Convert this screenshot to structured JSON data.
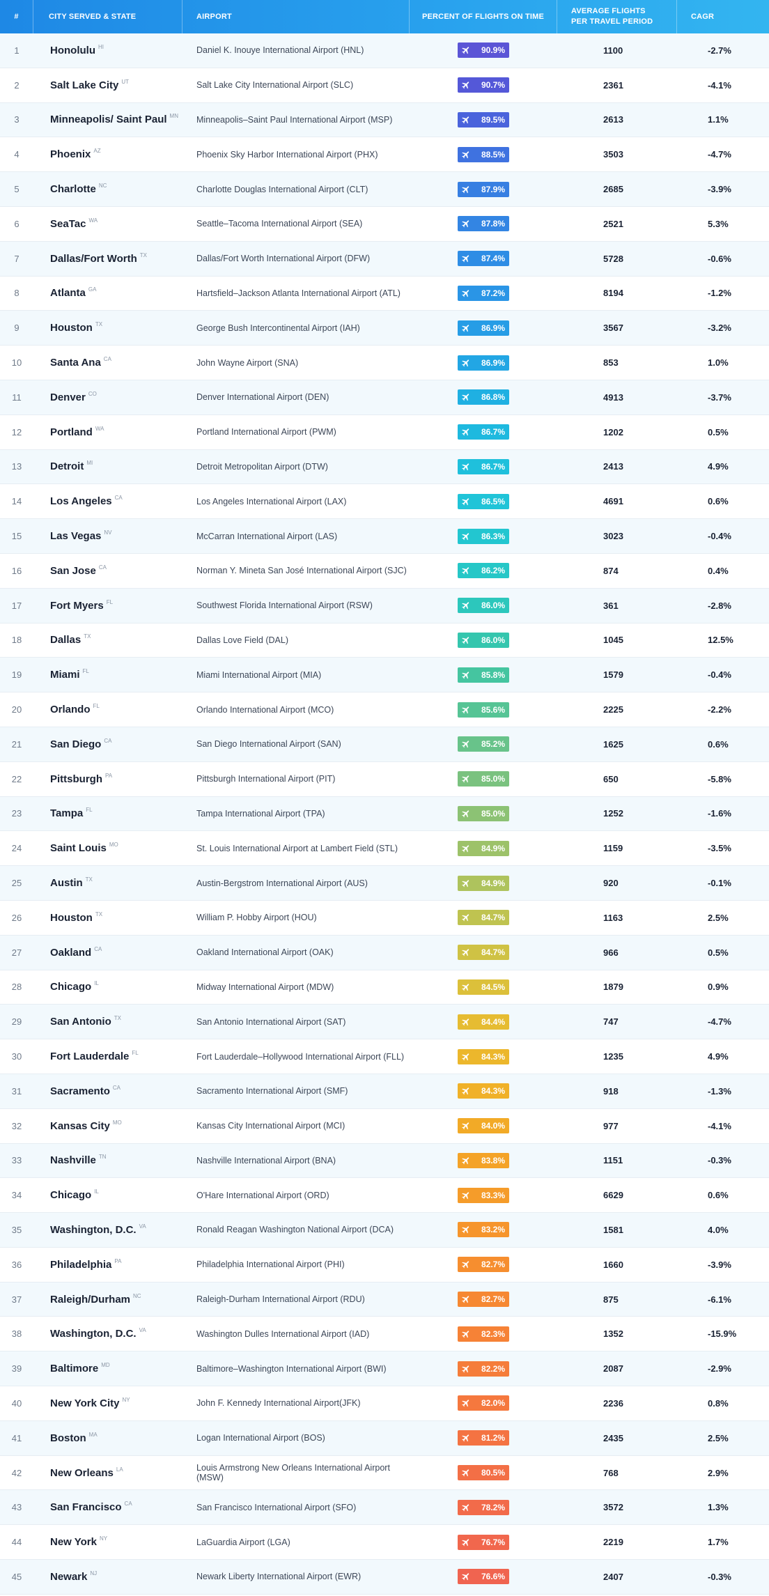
{
  "header": {
    "num": "#",
    "city": "City Served & State",
    "airport": "Airport",
    "percent": "Percent of Flights on Time",
    "avg_line1": "Average Flights",
    "avg_line2": "per Travel Period",
    "cagr": "CAGR"
  },
  "badge_icon": "airplane-icon",
  "rows": [
    {
      "num": "1",
      "city": "Honolulu",
      "state": "HI",
      "airport": "Daniel K. Inouye International Airport (HNL)",
      "pct": "90.9%",
      "color": "#5b55d6",
      "avg": "1100",
      "cagr": "-2.7%"
    },
    {
      "num": "2",
      "city": "Salt Lake City",
      "state": "UT",
      "airport": "Salt Lake City International Airport (SLC)",
      "pct": "90.7%",
      "color": "#5458d8",
      "avg": "2361",
      "cagr": "-4.1%"
    },
    {
      "num": "3",
      "city": "Minneapolis/ Saint Paul",
      "state": "MN",
      "airport": "Minneapolis–Saint Paul International Airport (MSP)",
      "pct": "89.5%",
      "color": "#4a63dc",
      "avg": "2613",
      "cagr": "1.1%"
    },
    {
      "num": "4",
      "city": "Phoenix",
      "state": "AZ",
      "airport": "Phoenix Sky Harbor International Airport (PHX)",
      "pct": "88.5%",
      "color": "#3f72e0",
      "avg": "3503",
      "cagr": "-4.7%"
    },
    {
      "num": "5",
      "city": "Charlotte",
      "state": "NC",
      "airport": "Charlotte Douglas International Airport (CLT)",
      "pct": "87.9%",
      "color": "#377fe2",
      "avg": "2685",
      "cagr": "-3.9%"
    },
    {
      "num": "6",
      "city": "SeaTac",
      "state": "WA",
      "airport": "Seattle–Tacoma International Airport (SEA)",
      "pct": "87.8%",
      "color": "#3385e3",
      "avg": "2521",
      "cagr": "5.3%"
    },
    {
      "num": "7",
      "city": "Dallas/Fort Worth",
      "state": "TX",
      "airport": "Dallas/Fort Worth International Airport (DFW)",
      "pct": "87.4%",
      "color": "#2e8de5",
      "avg": "5728",
      "cagr": "-0.6%"
    },
    {
      "num": "8",
      "city": "Atlanta",
      "state": "GA",
      "airport": "Hartsfield–Jackson Atlanta International Airport (ATL)",
      "pct": "87.2%",
      "color": "#2a95e6",
      "avg": "8194",
      "cagr": "-1.2%"
    },
    {
      "num": "9",
      "city": "Houston",
      "state": "TX",
      "airport": "George Bush Intercontinental Airport (IAH)",
      "pct": "86.9%",
      "color": "#269de6",
      "avg": "3567",
      "cagr": "-3.2%"
    },
    {
      "num": "10",
      "city": "Santa Ana",
      "state": "CA",
      "airport": "John Wayne Airport (SNA)",
      "pct": "86.9%",
      "color": "#22a6e4",
      "avg": "853",
      "cagr": "1.0%"
    },
    {
      "num": "11",
      "city": "Denver",
      "state": "CO",
      "airport": "Denver International Airport (DEN)",
      "pct": "86.8%",
      "color": "#1fb0e2",
      "avg": "4913",
      "cagr": "-3.7%"
    },
    {
      "num": "12",
      "city": "Portland",
      "state": "WA",
      "airport": "Portland International Airport (PWM)",
      "pct": "86.7%",
      "color": "#1eb9df",
      "avg": "1202",
      "cagr": "0.5%"
    },
    {
      "num": "13",
      "city": "Detroit",
      "state": "MI",
      "airport": "Detroit Metropolitan Airport (DTW)",
      "pct": "86.7%",
      "color": "#1fc0dc",
      "avg": "2413",
      "cagr": "4.9%"
    },
    {
      "num": "14",
      "city": "Los Angeles",
      "state": "CA",
      "airport": "Los Angeles International Airport (LAX)",
      "pct": "86.5%",
      "color": "#20c4d8",
      "avg": "4691",
      "cagr": "0.6%"
    },
    {
      "num": "15",
      "city": "Las Vegas",
      "state": "NV",
      "airport": "McCarran International Airport (LAS)",
      "pct": "86.3%",
      "color": "#22c6d0",
      "avg": "3023",
      "cagr": "-0.4%"
    },
    {
      "num": "16",
      "city": "San Jose",
      "state": "CA",
      "airport": "Norman Y. Mineta San José International Airport (SJC)",
      "pct": "86.2%",
      "color": "#26c7c7",
      "avg": "874",
      "cagr": "0.4%"
    },
    {
      "num": "17",
      "city": "Fort Myers",
      "state": "FL",
      "airport": "Southwest Florida International Airport (RSW)",
      "pct": "86.0%",
      "color": "#2cc7bc",
      "avg": "361",
      "cagr": "-2.8%"
    },
    {
      "num": "18",
      "city": "Dallas",
      "state": "TX",
      "airport": "Dallas Love Field (DAL)",
      "pct": "86.0%",
      "color": "#35c6ae",
      "avg": "1045",
      "cagr": "12.5%"
    },
    {
      "num": "19",
      "city": "Miami",
      "state": "FL",
      "airport": "Miami International Airport (MIA)",
      "pct": "85.8%",
      "color": "#45c5a0",
      "avg": "1579",
      "cagr": "-0.4%"
    },
    {
      "num": "20",
      "city": "Orlando",
      "state": "FL",
      "airport": "Orlando International Airport (MCO)",
      "pct": "85.6%",
      "color": "#56c495",
      "avg": "2225",
      "cagr": "-2.2%"
    },
    {
      "num": "21",
      "city": "San Diego",
      "state": "CA",
      "airport": "San Diego International Airport (SAN)",
      "pct": "85.2%",
      "color": "#68c38a",
      "avg": "1625",
      "cagr": "0.6%"
    },
    {
      "num": "22",
      "city": "Pittsburgh",
      "state": "PA",
      "airport": "Pittsburgh International Airport (PIT)",
      "pct": "85.0%",
      "color": "#7ac27f",
      "avg": "650",
      "cagr": "-5.8%"
    },
    {
      "num": "23",
      "city": "Tampa",
      "state": "FL",
      "airport": "Tampa International Airport (TPA)",
      "pct": "85.0%",
      "color": "#8cc274",
      "avg": "1252",
      "cagr": "-1.6%"
    },
    {
      "num": "24",
      "city": "Saint Louis",
      "state": "MO",
      "airport": "St. Louis International Airport at Lambert Field (STL)",
      "pct": "84.9%",
      "color": "#9dc269",
      "avg": "1159",
      "cagr": "-3.5%"
    },
    {
      "num": "25",
      "city": "Austin",
      "state": "TX",
      "airport": "Austin-Bergstrom International Airport (AUS)",
      "pct": "84.9%",
      "color": "#aec35d",
      "avg": "920",
      "cagr": "-0.1%"
    },
    {
      "num": "26",
      "city": "Houston",
      "state": "TX",
      "airport": "William P. Hobby Airport (HOU)",
      "pct": "84.7%",
      "color": "#bfc350",
      "avg": "1163",
      "cagr": "2.5%"
    },
    {
      "num": "27",
      "city": "Oakland",
      "state": "CA",
      "airport": "Oakland International Airport (OAK)",
      "pct": "84.7%",
      "color": "#cfc244",
      "avg": "966",
      "cagr": "0.5%"
    },
    {
      "num": "28",
      "city": "Chicago",
      "state": "IL",
      "airport": "Midway International Airport (MDW)",
      "pct": "84.5%",
      "color": "#dcc03a",
      "avg": "1879",
      "cagr": "0.9%"
    },
    {
      "num": "29",
      "city": "San Antonio",
      "state": "TX",
      "airport": "San Antonio International Airport (SAT)",
      "pct": "84.4%",
      "color": "#e6bc32",
      "avg": "747",
      "cagr": "-4.7%"
    },
    {
      "num": "30",
      "city": "Fort Lauderdale",
      "state": "FL",
      "airport": "Fort Lauderdale–Hollywood International Airport (FLL)",
      "pct": "84.3%",
      "color": "#ecb72c",
      "avg": "1235",
      "cagr": "4.9%"
    },
    {
      "num": "31",
      "city": "Sacramento",
      "state": "CA",
      "airport": "Sacramento International Airport (SMF)",
      "pct": "84.3%",
      "color": "#f0b128",
      "avg": "918",
      "cagr": "-1.3%"
    },
    {
      "num": "32",
      "city": "Kansas City",
      "state": "MO",
      "airport": "Kansas City International Airport (MCI)",
      "pct": "84.0%",
      "color": "#f2aa27",
      "avg": "977",
      "cagr": "-4.1%"
    },
    {
      "num": "33",
      "city": "Nashville",
      "state": "TN",
      "airport": "Nashville International Airport (BNA)",
      "pct": "83.8%",
      "color": "#f4a328",
      "avg": "1151",
      "cagr": "-0.3%"
    },
    {
      "num": "34",
      "city": "Chicago",
      "state": "IL",
      "airport": "O'Hare International Airport (ORD)",
      "pct": "83.3%",
      "color": "#f59c2a",
      "avg": "6629",
      "cagr": "0.6%"
    },
    {
      "num": "35",
      "city": "Washington, D.C.",
      "state": "VA",
      "airport": "Ronald Reagan Washington National Airport (DCA)",
      "pct": "83.2%",
      "color": "#f6952c",
      "avg": "1581",
      "cagr": "4.0%"
    },
    {
      "num": "36",
      "city": "Philadelphia",
      "state": "PA",
      "airport": "Philadelphia International Airport (PHI)",
      "pct": "82.7%",
      "color": "#f68e2f",
      "avg": "1660",
      "cagr": "-3.9%"
    },
    {
      "num": "37",
      "city": "Raleigh/Durham",
      "state": "NC",
      "airport": "Raleigh-Durham International Airport (RDU)",
      "pct": "82.7%",
      "color": "#f68832",
      "avg": "875",
      "cagr": "-6.1%"
    },
    {
      "num": "38",
      "city": "Washington, D.C.",
      "state": "VA",
      "airport": "Washington Dulles International Airport (IAD)",
      "pct": "82.3%",
      "color": "#f68236",
      "avg": "1352",
      "cagr": "-15.9%"
    },
    {
      "num": "39",
      "city": "Baltimore",
      "state": "MD",
      "airport": "Baltimore–Washington International Airport (BWI)",
      "pct": "82.2%",
      "color": "#f57d3a",
      "avg": "2087",
      "cagr": "-2.9%"
    },
    {
      "num": "40",
      "city": "New York City",
      "state": "NY",
      "airport": "John F. Kennedy International Airport(JFK)",
      "pct": "82.0%",
      "color": "#f5783e",
      "avg": "2236",
      "cagr": "0.8%"
    },
    {
      "num": "41",
      "city": "Boston",
      "state": "MA",
      "airport": "Logan International Airport (BOS)",
      "pct": "81.2%",
      "color": "#f47342",
      "avg": "2435",
      "cagr": "2.5%"
    },
    {
      "num": "42",
      "city": "New Orleans",
      "state": "LA",
      "airport": "Louis Armstrong New Orleans International Airport (MSW)",
      "pct": "80.5%",
      "color": "#f36f46",
      "avg": "768",
      "cagr": "2.9%"
    },
    {
      "num": "43",
      "city": "San Francisco",
      "state": "CA",
      "airport": "San Francisco International Airport (SFO)",
      "pct": "78.2%",
      "color": "#f26b4a",
      "avg": "3572",
      "cagr": "1.3%"
    },
    {
      "num": "44",
      "city": "New York",
      "state": "NY",
      "airport": "LaGuardia Airport (LGA)",
      "pct": "76.7%",
      "color": "#f1674d",
      "avg": "2219",
      "cagr": "1.7%"
    },
    {
      "num": "45",
      "city": "Newark",
      "state": "NJ",
      "airport": "Newark Liberty International Airport (EWR)",
      "pct": "76.6%",
      "color": "#f06450",
      "avg": "2407",
      "cagr": "-0.3%"
    }
  ]
}
